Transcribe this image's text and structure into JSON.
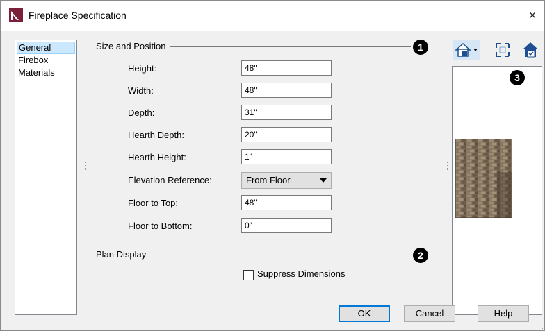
{
  "window": {
    "title": "Fireplace Specification",
    "close_label": "×"
  },
  "nav": {
    "items": [
      "General",
      "Firebox",
      "Materials"
    ],
    "selected": "General"
  },
  "size_position": {
    "title": "Size and Position",
    "callout": "1",
    "fields": [
      {
        "label": "Height:",
        "value": "48\""
      },
      {
        "label": "Width:",
        "value": "48\""
      },
      {
        "label": "Depth:",
        "value": "31\""
      },
      {
        "label": "Hearth Depth:",
        "value": "20\""
      },
      {
        "label": "Hearth Height:",
        "value": "1\""
      }
    ],
    "elevation": {
      "label": "Elevation Reference:",
      "value": "From Floor"
    },
    "fields2": [
      {
        "label": "Floor to Top:",
        "value": "48\""
      },
      {
        "label": "Floor to Bottom:",
        "value": "0\""
      }
    ]
  },
  "plan_display": {
    "title": "Plan Display",
    "callout": "2",
    "suppress_label": "Suppress Dimensions",
    "suppress_checked": false
  },
  "preview": {
    "callout": "3"
  },
  "buttons": {
    "ok": "OK",
    "cancel": "Cancel",
    "help": "Help"
  },
  "colors": {
    "selection": "#cce8ff",
    "accent": "#0078d7",
    "brand": "#7b1f3a"
  }
}
